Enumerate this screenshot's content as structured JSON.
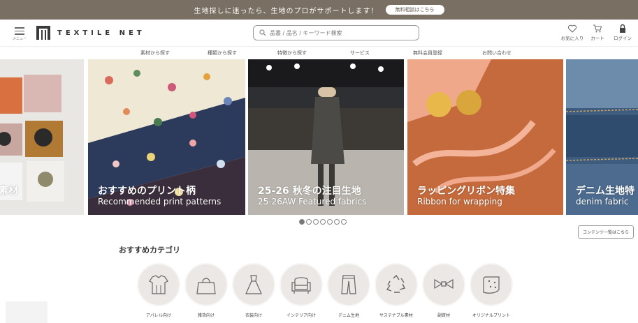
{
  "topbar": {
    "message": "生地探しに迷ったら、生地のプロがサポートします！",
    "cta": "無料相談はこちら"
  },
  "header": {
    "menu_label": "メニュー",
    "logo_text": "TEXTILE NET",
    "search_placeholder": "品番 / 品名 / キーワード検索",
    "favorites_label": "お気に入り",
    "cart_label": "カート",
    "login_label": "ログイン"
  },
  "nav": {
    "items": [
      "素材から探す",
      "種類から探す",
      "特徴から探す",
      "サービス",
      "無料会員登録",
      "お問い合わせ"
    ]
  },
  "carousel": {
    "slides": [
      {
        "title": "素材",
        "subtitle": ""
      },
      {
        "title": "おすすめのプリント柄",
        "subtitle": "Recommended print patterns"
      },
      {
        "title": "25-26 秋冬の注目生地",
        "subtitle": "25-26AW Featured fabrics"
      },
      {
        "title": "ラッピングリボン特集",
        "subtitle": "Ribbon for wrapping"
      },
      {
        "title": "デニム生地特",
        "subtitle": "denim fabric"
      }
    ],
    "dot_count": 7,
    "active_dot": 1
  },
  "content_list_link": "コンテンツ一覧はこちら",
  "categories": {
    "title": "おすすめカテゴリ",
    "items": [
      {
        "label": "アパレル向け",
        "icon": "apparel-icon"
      },
      {
        "label": "雑貨向け",
        "icon": "bag-icon"
      },
      {
        "label": "衣装向け",
        "icon": "dress-icon"
      },
      {
        "label": "インテリア向け",
        "icon": "sofa-icon"
      },
      {
        "label": "デニム生地",
        "icon": "jeans-icon"
      },
      {
        "label": "サステナブル素材",
        "icon": "recycle-icon"
      },
      {
        "label": "副資材",
        "icon": "ribbon-icon"
      },
      {
        "label": "オリジナルプリント",
        "icon": "print-icon"
      }
    ]
  },
  "colors": {
    "topbar": "#7a6f63",
    "category_circle": "#ebe8e5",
    "text": "#333333"
  }
}
